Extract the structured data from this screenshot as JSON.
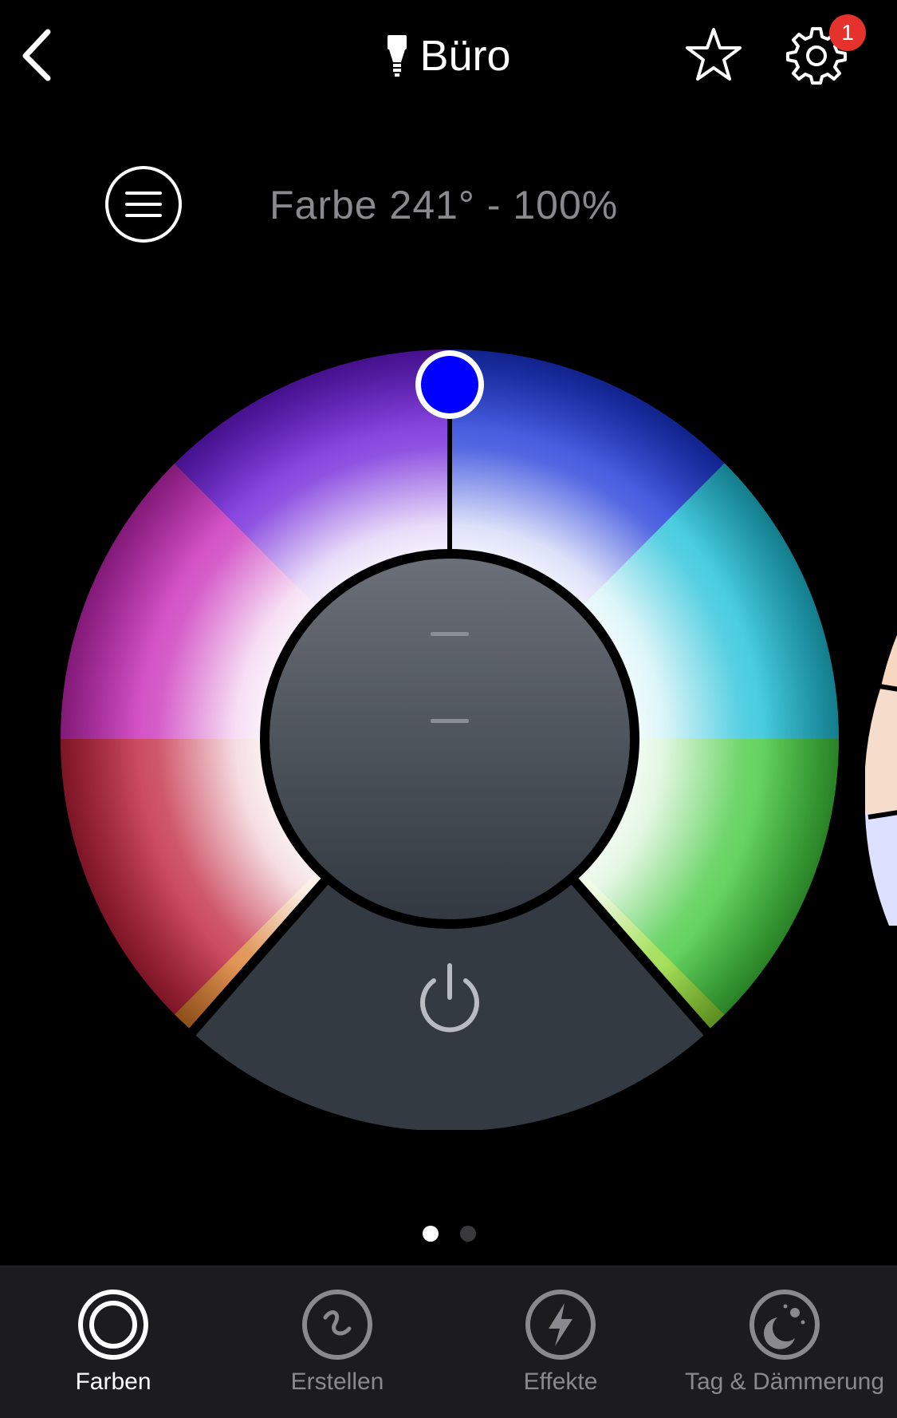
{
  "header": {
    "title": "Büro",
    "icons": {
      "back": "chevron-left-icon",
      "bulb": "lightbulb-icon",
      "favorite": "star-icon",
      "settings": "gear-icon"
    },
    "settings_badge": "1"
  },
  "status": {
    "text": "Farbe 241° - 100%",
    "menu_icon": "hamburger-icon"
  },
  "color_wheel": {
    "hue_degrees": 241,
    "brightness_percent": 100,
    "selected_color": "#0000ff",
    "power_icon": "power-icon"
  },
  "pager": {
    "pages": 2,
    "current": 1
  },
  "tabs": [
    {
      "label": "Farben",
      "icon": "rings-icon",
      "active": true
    },
    {
      "label": "Erstellen",
      "icon": "squiggle-icon",
      "active": false
    },
    {
      "label": "Effekte",
      "icon": "lightning-icon",
      "active": false
    },
    {
      "label": "Tag & Dämmerung",
      "icon": "moon-sun-icon",
      "active": false
    }
  ],
  "colors": {
    "background": "#000000",
    "tabbar": "#1c1c1e",
    "inactive_text": "#8a8a8e",
    "badge": "#e5322d",
    "hub_top": "#6b7079",
    "hub_bottom": "#323840"
  }
}
